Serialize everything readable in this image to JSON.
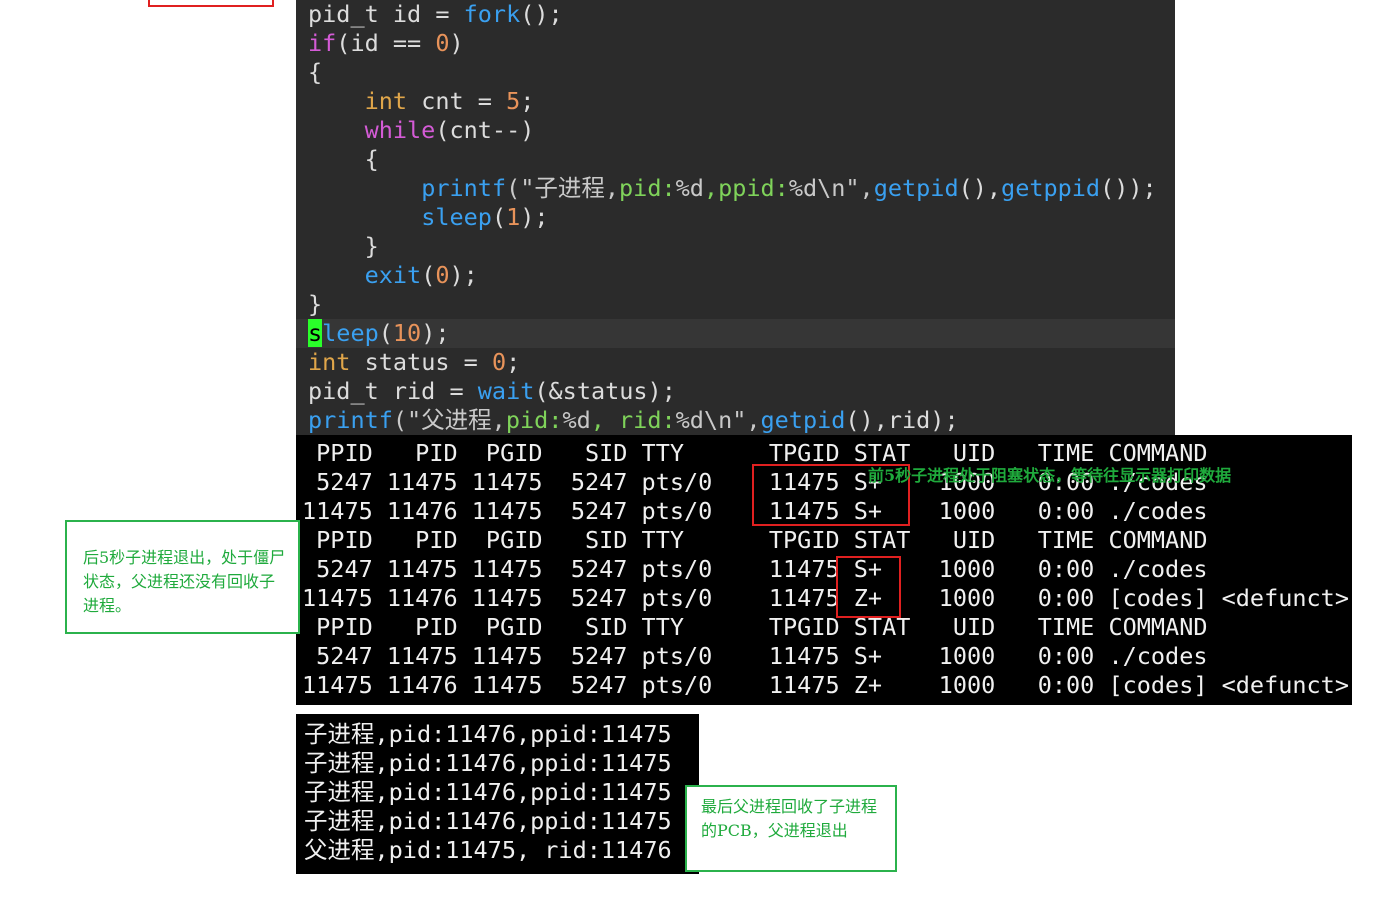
{
  "code": {
    "l1": [
      "pid_t id = ",
      "fork",
      "();"
    ],
    "l2": [
      "if",
      "(id == ",
      "0",
      ")"
    ],
    "l3": "{",
    "l4": [
      "    ",
      "int",
      " cnt = ",
      "5",
      ";"
    ],
    "l5": [
      "    ",
      "while",
      "(cnt--)"
    ],
    "l6": "    {",
    "l7": [
      "        ",
      "printf",
      "(\"子进程,",
      "pid:",
      "%d",
      ",ppid:",
      "%d\\n\",",
      "getpid",
      "(),",
      "getppid",
      "());"
    ],
    "l8": [
      "        ",
      "sleep",
      "(",
      "1",
      ");"
    ],
    "l9": "    }",
    "l10": [
      "    ",
      "exit",
      "(",
      "0",
      ");"
    ],
    "l11": "}",
    "l12": [
      "s",
      "leep",
      "(",
      "10",
      ");"
    ],
    "l13": [
      "int",
      " status = ",
      "0",
      ";"
    ],
    "l14": [
      "pid_t rid = ",
      "wait",
      "(&status);"
    ],
    "l15": [
      "printf",
      "(\"父进程,",
      "pid:",
      "%d",
      ", rid:",
      "%d\\n\",",
      "getpid",
      "(),rid);"
    ]
  },
  "ps_output": [
    " PPID   PID  PGID   SID TTY      TPGID STAT   UID   TIME COMMAND",
    " 5247 11475 11475  5247 pts/0    11475 S+    1000   0:00 ./codes",
    "11475 11476 11475  5247 pts/0    11475 S+    1000   0:00 ./codes",
    " PPID   PID  PGID   SID TTY      TPGID STAT   UID   TIME COMMAND",
    " 5247 11475 11475  5247 pts/0    11475 S+    1000   0:00 ./codes",
    "11475 11476 11475  5247 pts/0    11475 Z+    1000   0:00 [codes] <defunct>",
    " PPID   PID  PGID   SID TTY      TPGID STAT   UID   TIME COMMAND",
    " 5247 11475 11475  5247 pts/0    11475 S+    1000   0:00 ./codes",
    "11475 11476 11475  5247 pts/0    11475 Z+    1000   0:00 [codes] <defunct>"
  ],
  "program_output": [
    "子进程,pid:11476,ppid:11475",
    "子进程,pid:11476,ppid:11475",
    "子进程,pid:11476,ppid:11475",
    "子进程,pid:11476,ppid:11475",
    "父进程,pid:11475, rid:11476"
  ],
  "annotations": {
    "first5": "前5秒子进程处于阻塞状态，等待往显示器打印数据",
    "after5": "后5秒子进程退出，处于僵尸状态，父进程还没有回收子进程。",
    "final": "最后父进程回收了子进程的PCB，父进程退出"
  },
  "colors": {
    "editor_bg": "#2b2b2b",
    "keyword": "#d45bd6",
    "type": "#e0a64a",
    "function": "#3aa0f0",
    "number": "#e8935a",
    "format": "#7fd35a",
    "annotation_green": "#2bb24c",
    "highlight_red": "#e02020"
  }
}
